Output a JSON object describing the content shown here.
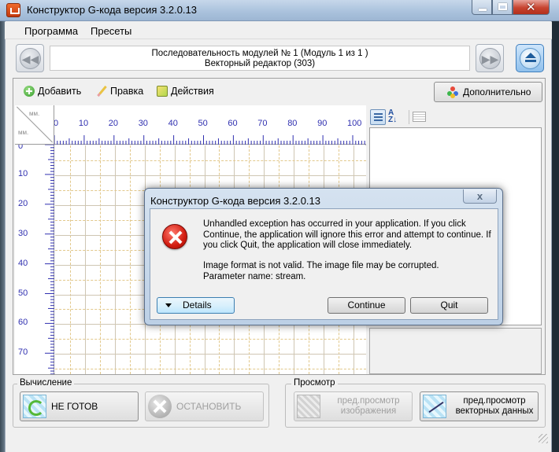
{
  "window": {
    "title": "Конструктор G-кода версия 3.2.0.13"
  },
  "menu": {
    "items": [
      "Программа",
      "Пресеты"
    ]
  },
  "sequence": {
    "line1": "Последовательность модулей № 1 (Модуль 1 из 1 )",
    "line2": "Векторный редактор (303)"
  },
  "toolbar": {
    "add_label": "Добавить",
    "edit_label": "Правка",
    "actions_label": "Действия",
    "more_label": "Дополнительно"
  },
  "ruler": {
    "unit": "мм.",
    "h_labels": [
      "0",
      "10",
      "20",
      "30",
      "40",
      "50",
      "60",
      "70",
      "80",
      "90",
      "100"
    ],
    "v_labels": [
      "0",
      "10",
      "20",
      "30",
      "40",
      "50",
      "60",
      "70"
    ]
  },
  "bottom": {
    "calc_label": "Вычисление",
    "preview_label": "Просмотр",
    "not_ready_label": "НЕ ГОТОВ",
    "stop_label": "ОСТАНОВИТЬ",
    "image_preview_label": "пред.просмотр изображения",
    "vector_preview_label": "пред.просмотр векторных данных"
  },
  "dialog": {
    "title": "Конструктор G-кода версия 3.2.0.13",
    "message": "Unhandled exception has occurred in your application. If you click Continue, the application will ignore this error and attempt to continue. If you click Quit, the application will close immediately.",
    "detail_line1": "Image format is not valid. The image file may be corrupted.",
    "detail_line2": "Parameter name: stream.",
    "details_label": "Details",
    "continue_label": "Continue",
    "quit_label": "Quit",
    "close_glyph": "x"
  },
  "icons": {
    "app": "app-icon",
    "add": "add-icon",
    "edit": "pencil-icon",
    "actions": "cube-icon",
    "error": "error-icon"
  }
}
